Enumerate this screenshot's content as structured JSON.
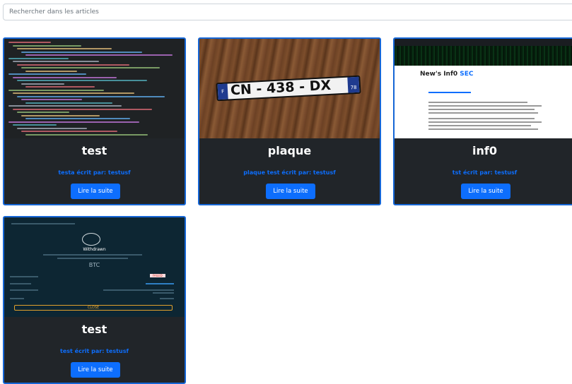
{
  "search": {
    "placeholder": "Rechercher dans les articles"
  },
  "cards": [
    {
      "title": "test",
      "author": "testa écrit par: testusf",
      "button": "Lire la suite"
    },
    {
      "title": "plaque",
      "author": "plaque test écrit par: testusf",
      "button": "Lire la suite",
      "plate_text": "CN - 438 - DX",
      "plate_left": "F",
      "plate_right": "78"
    },
    {
      "title": "inf0",
      "author": "tst écrit par: testusf",
      "button": "Lire la suite",
      "site_title": "New's Inf0",
      "site_title_accent": "SEC"
    },
    {
      "title": "test",
      "author": "test écrit par: testusf",
      "button": "Lire la suite",
      "wallet_status": "Withdrawn",
      "wallet_close": "CLOSE",
      "wallet_amount": "BTC",
      "wallet_failed": "FAILED"
    }
  ],
  "colors": {
    "card_bg": "#212529",
    "accent": "#0d6efd",
    "border": "#1566d6"
  }
}
